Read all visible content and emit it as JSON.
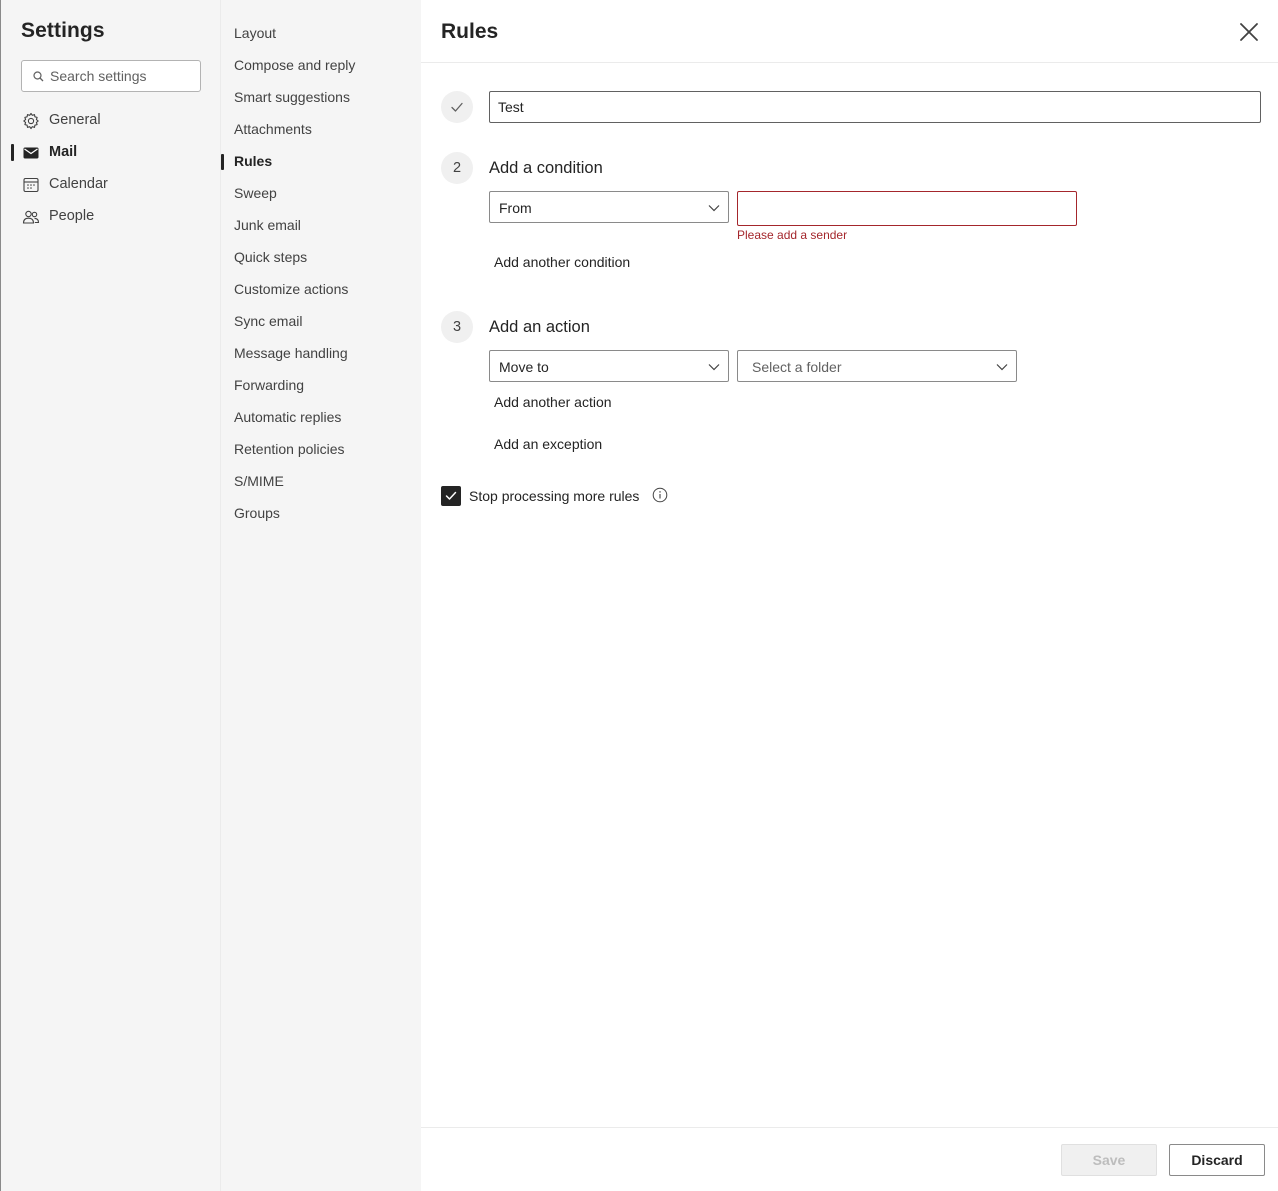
{
  "settings": {
    "title": "Settings",
    "search_placeholder": "Search settings"
  },
  "categories": [
    {
      "label": "General",
      "icon": "gear-icon"
    },
    {
      "label": "Mail",
      "icon": "mail-icon",
      "active": true
    },
    {
      "label": "Calendar",
      "icon": "calendar-icon"
    },
    {
      "label": "People",
      "icon": "people-icon"
    }
  ],
  "mail_nav": [
    {
      "label": "Layout"
    },
    {
      "label": "Compose and reply"
    },
    {
      "label": "Smart suggestions"
    },
    {
      "label": "Attachments"
    },
    {
      "label": "Rules",
      "active": true
    },
    {
      "label": "Sweep"
    },
    {
      "label": "Junk email"
    },
    {
      "label": "Quick steps"
    },
    {
      "label": "Customize actions"
    },
    {
      "label": "Sync email"
    },
    {
      "label": "Message handling"
    },
    {
      "label": "Forwarding"
    },
    {
      "label": "Automatic replies"
    },
    {
      "label": "Retention policies"
    },
    {
      "label": "S/MIME"
    },
    {
      "label": "Groups"
    }
  ],
  "rules": {
    "title": "Rules",
    "rule_name_value": "Test",
    "condition": {
      "step": "2",
      "heading": "Add a condition",
      "type_selected": "From",
      "value": "",
      "error": "Please add a sender",
      "add_another": "Add another condition"
    },
    "action": {
      "step": "3",
      "heading": "Add an action",
      "type_selected": "Move to",
      "folder_placeholder": "Select a folder",
      "add_another": "Add another action",
      "add_exception": "Add an exception"
    },
    "stop_processing": {
      "label": "Stop processing more rules",
      "checked": true
    },
    "footer": {
      "save_label": "Save",
      "discard_label": "Discard"
    }
  },
  "colors": {
    "error": "#a4262c",
    "text": "#242424",
    "panel_bg": "#f5f5f5"
  }
}
